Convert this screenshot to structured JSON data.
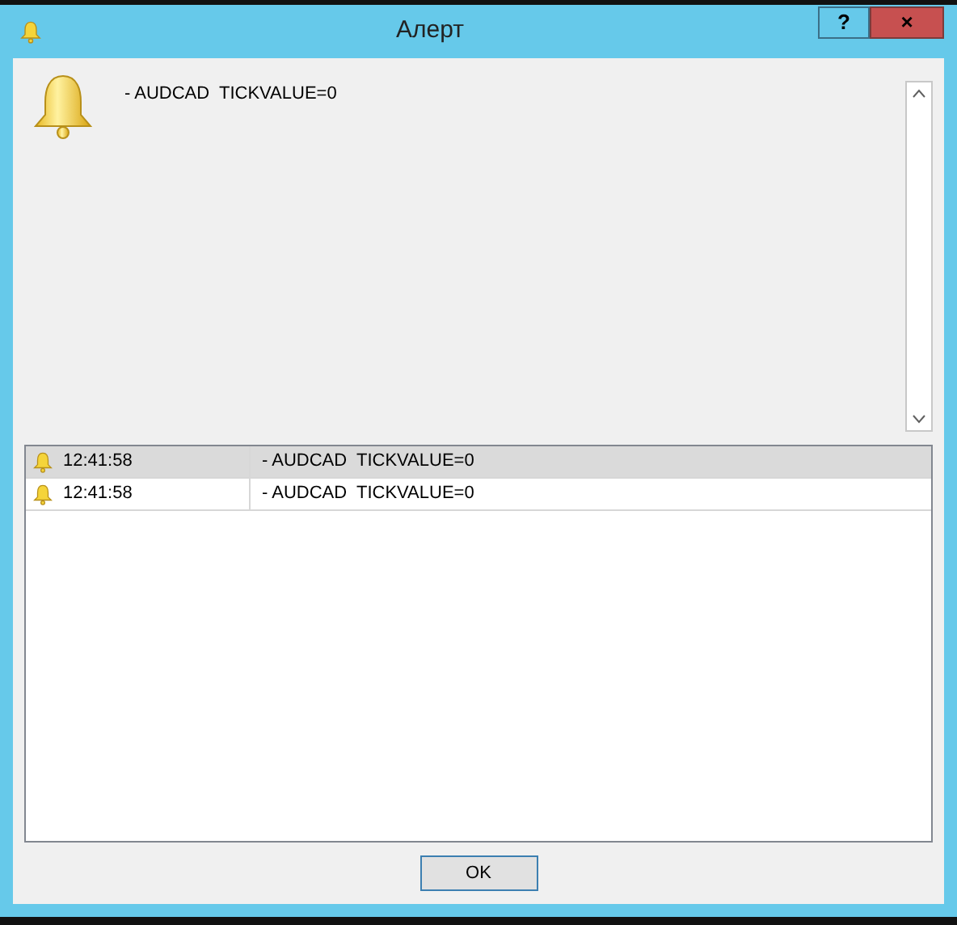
{
  "window": {
    "title": "Алерт",
    "help_button": "?",
    "close_button": "×"
  },
  "message": "- AUDCAD  TICKVALUE=0",
  "alerts": [
    {
      "time": "12:41:58",
      "text": "- AUDCAD  TICKVALUE=0",
      "selected": true
    },
    {
      "time": "12:41:58",
      "text": "- AUDCAD  TICKVALUE=0",
      "selected": false
    }
  ],
  "buttons": [
    "OK"
  ]
}
